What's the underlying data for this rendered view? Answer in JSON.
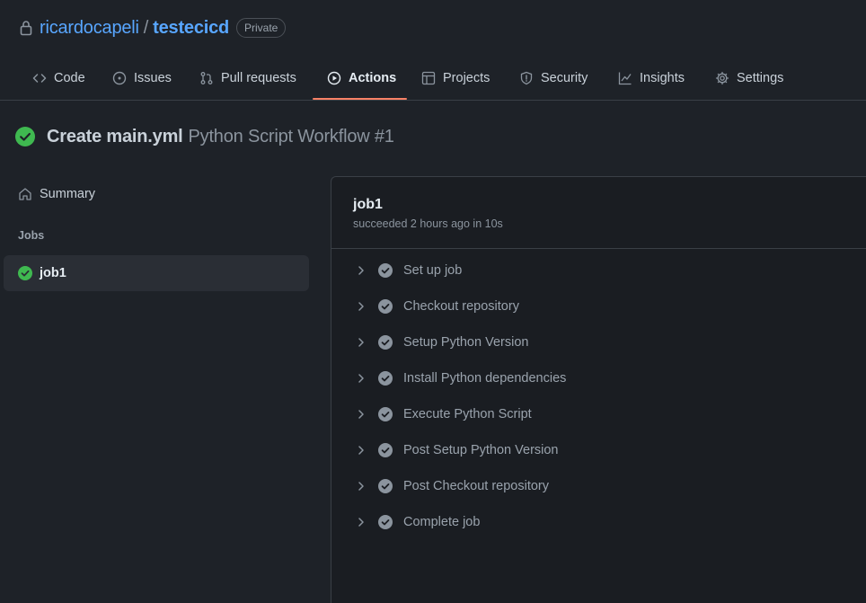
{
  "repo": {
    "owner": "ricardocapeli",
    "separator": "/",
    "name": "testecicd",
    "visibility": "Private"
  },
  "tabs": [
    {
      "label": "Code",
      "icon": "code-icon"
    },
    {
      "label": "Issues",
      "icon": "issue-icon"
    },
    {
      "label": "Pull requests",
      "icon": "pull-request-icon"
    },
    {
      "label": "Actions",
      "icon": "play-icon",
      "active": true
    },
    {
      "label": "Projects",
      "icon": "table-icon"
    },
    {
      "label": "Security",
      "icon": "shield-icon"
    },
    {
      "label": "Insights",
      "icon": "graph-icon"
    },
    {
      "label": "Settings",
      "icon": "gear-icon"
    }
  ],
  "run": {
    "commit": "Create main.yml",
    "workflow": "Python Script Workflow #1",
    "status_icon": "check-circle-icon"
  },
  "sidebar": {
    "summary": "Summary",
    "jobs_label": "Jobs",
    "jobs": [
      {
        "label": "job1"
      }
    ]
  },
  "job": {
    "name": "job1",
    "status": "succeeded 2 hours ago in 10s",
    "steps": [
      {
        "label": "Set up job"
      },
      {
        "label": "Checkout repository"
      },
      {
        "label": "Setup Python Version"
      },
      {
        "label": "Install Python dependencies"
      },
      {
        "label": "Execute Python Script"
      },
      {
        "label": "Post Setup Python Version"
      },
      {
        "label": "Post Checkout repository"
      },
      {
        "label": "Complete job"
      }
    ]
  },
  "colors": {
    "accent_link": "#58a6ff",
    "success": "#3fb950",
    "tab_underline": "#f78166",
    "background": "#1e2228"
  }
}
